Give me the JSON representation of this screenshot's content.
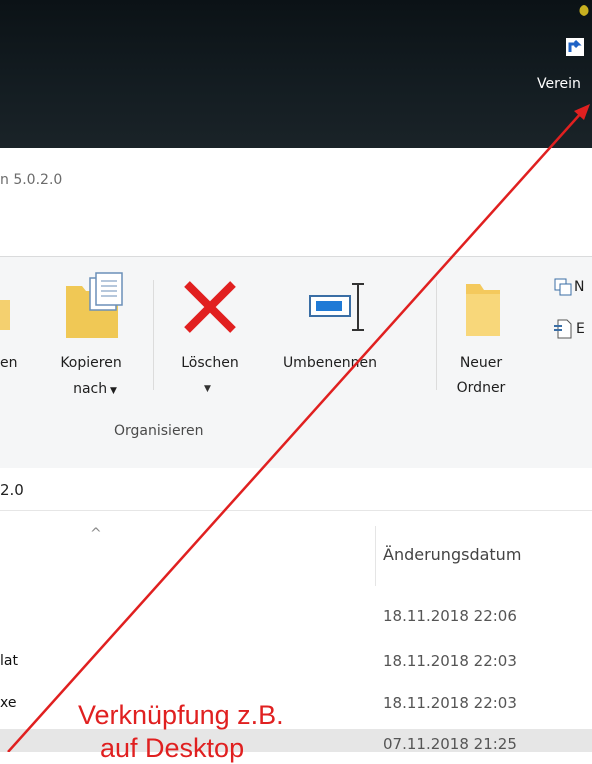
{
  "desktop": {
    "shortcut_label": "Verein"
  },
  "window": {
    "title_fragment": "n 5.0.2.0"
  },
  "ribbon": {
    "buttons": {
      "move_fragment": "en",
      "copy_line1": "Kopieren",
      "copy_line2": "nach",
      "delete": "Löschen",
      "rename": "Umbenennen",
      "new_folder_line1": "Neuer",
      "new_folder_line2": "Ordner",
      "new_item_fragment": "N",
      "easy_access_fragment": "E"
    },
    "group_label": "Organisieren"
  },
  "address_bar": {
    "path_fragment": "2.0"
  },
  "file_list": {
    "column_header": "Änderungsdatum",
    "rows": [
      {
        "name_fragment": "",
        "date": "18.11.2018 22:06"
      },
      {
        "name_fragment": "lat",
        "date": "18.11.2018 22:03"
      },
      {
        "name_fragment": "xe",
        "date": "18.11.2018 22:03"
      },
      {
        "name_fragment": "",
        "date": "07.11.2018 21:25"
      }
    ]
  },
  "annotation": {
    "line1": "Verknüpfung z.B.",
    "line2": "auf Desktop",
    "color": "#e02020"
  }
}
